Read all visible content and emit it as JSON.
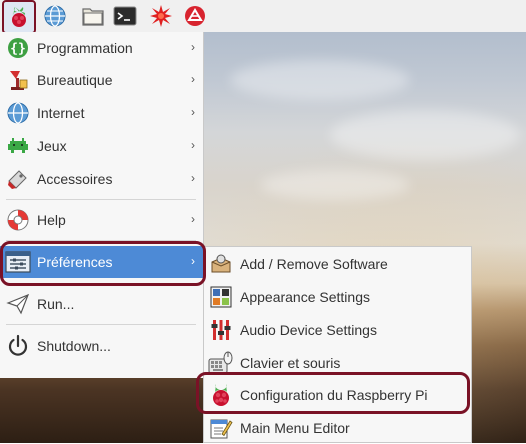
{
  "panel": {
    "launchers": [
      {
        "icon": "raspberry-menu-icon"
      },
      {
        "icon": "web-browser-globe-icon"
      },
      {
        "icon": "file-manager-folder-icon"
      },
      {
        "icon": "terminal-icon"
      },
      {
        "icon": "wolfram-icon"
      },
      {
        "icon": "mathematica-icon"
      }
    ]
  },
  "menu": {
    "items": [
      {
        "label": "Programmation",
        "icon": "programming-icon"
      },
      {
        "label": "Bureautique",
        "icon": "office-icon"
      },
      {
        "label": "Internet",
        "icon": "internet-globe-icon"
      },
      {
        "label": "Jeux",
        "icon": "games-icon"
      },
      {
        "label": "Accessoires",
        "icon": "accessories-icon"
      },
      {
        "label": "Help",
        "icon": "help-lifebuoy-icon"
      },
      {
        "label": "Préférences",
        "icon": "preferences-icon"
      },
      {
        "label": "Run...",
        "icon": "run-paper-plane-icon"
      },
      {
        "label": "Shutdown...",
        "icon": "shutdown-power-icon"
      }
    ]
  },
  "submenu": {
    "items": [
      {
        "label": "Add / Remove Software",
        "icon": "add-remove-software-icon"
      },
      {
        "label": "Appearance Settings",
        "icon": "appearance-settings-icon"
      },
      {
        "label": "Audio Device Settings",
        "icon": "audio-device-settings-icon"
      },
      {
        "label": "Clavier et souris",
        "icon": "keyboard-mouse-icon"
      },
      {
        "label": "Configuration du Raspberry Pi",
        "icon": "raspberry-pi-config-icon"
      },
      {
        "label": "Main Menu Editor",
        "icon": "main-menu-editor-icon"
      }
    ]
  },
  "colors": {
    "highlight": "#4d8ad6",
    "annotation": "#7a1226",
    "menu_background": "#f7f7f7",
    "panel_background": "#f0f0f0"
  }
}
